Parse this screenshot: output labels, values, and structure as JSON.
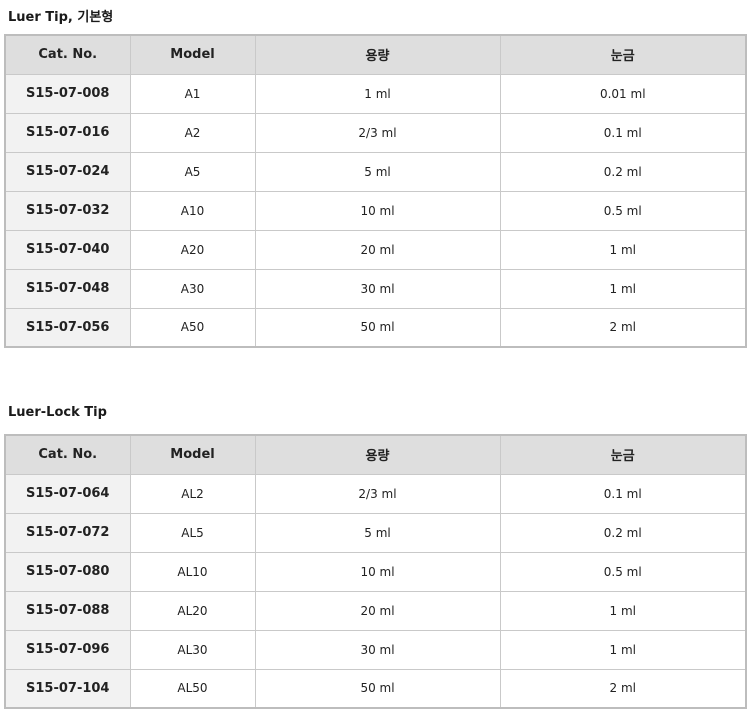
{
  "sections": [
    {
      "title": "Luer Tip, 기본형",
      "headers": [
        "Cat. No.",
        "Model",
        "용량",
        "눈금"
      ],
      "rows": [
        [
          "S15-07-008",
          "A1",
          "1 ml",
          "0.01 ml"
        ],
        [
          "S15-07-016",
          "A2",
          "2/3 ml",
          "0.1 ml"
        ],
        [
          "S15-07-024",
          "A5",
          "5 ml",
          "0.2 ml"
        ],
        [
          "S15-07-032",
          "A10",
          "10 ml",
          "0.5 ml"
        ],
        [
          "S15-07-040",
          "A20",
          "20 ml",
          "1 ml"
        ],
        [
          "S15-07-048",
          "A30",
          "30 ml",
          "1 ml"
        ],
        [
          "S15-07-056",
          "A50",
          "50 ml",
          "2 ml"
        ]
      ]
    },
    {
      "title": "Luer-Lock Tip",
      "headers": [
        "Cat. No.",
        "Model",
        "용량",
        "눈금"
      ],
      "rows": [
        [
          "S15-07-064",
          "AL2",
          "2/3 ml",
          "0.1 ml"
        ],
        [
          "S15-07-072",
          "AL5",
          "5 ml",
          "0.2 ml"
        ],
        [
          "S15-07-080",
          "AL10",
          "10 ml",
          "0.5 ml"
        ],
        [
          "S15-07-088",
          "AL20",
          "20 ml",
          "1 ml"
        ],
        [
          "S15-07-096",
          "AL30",
          "30 ml",
          "1 ml"
        ],
        [
          "S15-07-104",
          "AL50",
          "50 ml",
          "2 ml"
        ]
      ]
    }
  ],
  "colors": {
    "header_bg": "#dedede",
    "catno_bg": "#f2f2f2",
    "border": "#c9c9c9"
  }
}
